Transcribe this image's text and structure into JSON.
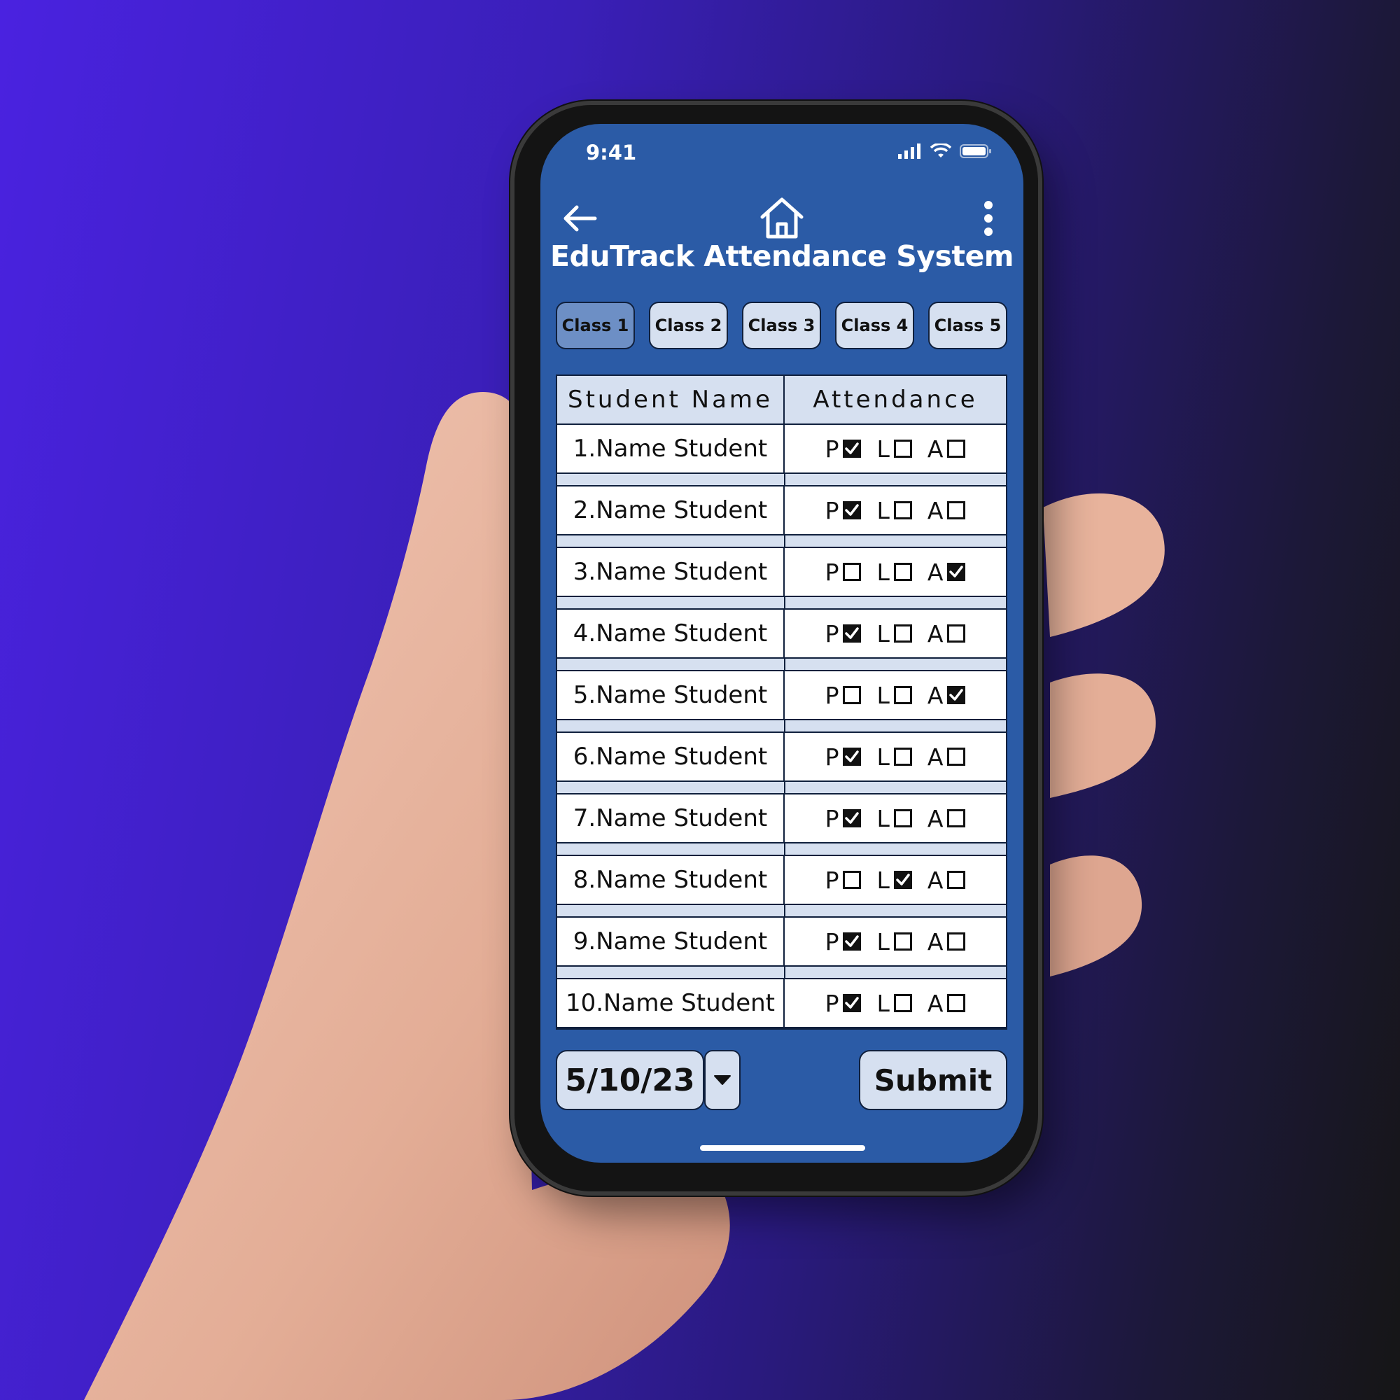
{
  "status": {
    "time": "9:41"
  },
  "app": {
    "title": "EduTrack Attendance System"
  },
  "tabs": [
    {
      "label": "Class 1",
      "active": true
    },
    {
      "label": "Class 2",
      "active": false
    },
    {
      "label": "Class 3",
      "active": false
    },
    {
      "label": "Class 4",
      "active": false
    },
    {
      "label": "Class 5",
      "active": false
    }
  ],
  "table": {
    "headers": {
      "name": "Student Name",
      "attendance": "Attendance"
    },
    "option_labels": {
      "present": "P",
      "late": "L",
      "absent": "A"
    },
    "rows": [
      {
        "name": "1.Name Student",
        "status": "P"
      },
      {
        "name": "2.Name Student",
        "status": "P"
      },
      {
        "name": "3.Name Student",
        "status": "A"
      },
      {
        "name": "4.Name Student",
        "status": "P"
      },
      {
        "name": "5.Name Student",
        "status": "A"
      },
      {
        "name": "6.Name Student",
        "status": "P"
      },
      {
        "name": "7.Name Student",
        "status": "P"
      },
      {
        "name": "8.Name Student",
        "status": "L"
      },
      {
        "name": "9.Name Student",
        "status": "P"
      },
      {
        "name": "10.Name Student",
        "status": "P"
      }
    ]
  },
  "footer": {
    "date": "5/10/23",
    "submit_label": "Submit"
  },
  "icons": {
    "back": "arrow-left-icon",
    "home": "home-icon",
    "menu": "more-vertical-icon",
    "dropdown": "caret-down-icon",
    "check": "checkmark-icon"
  },
  "colors": {
    "screen_bg": "#2b5ba6",
    "tab_bg": "#d6e0f0",
    "tab_active_bg": "#6d8fc5",
    "text_dark": "#111111"
  }
}
